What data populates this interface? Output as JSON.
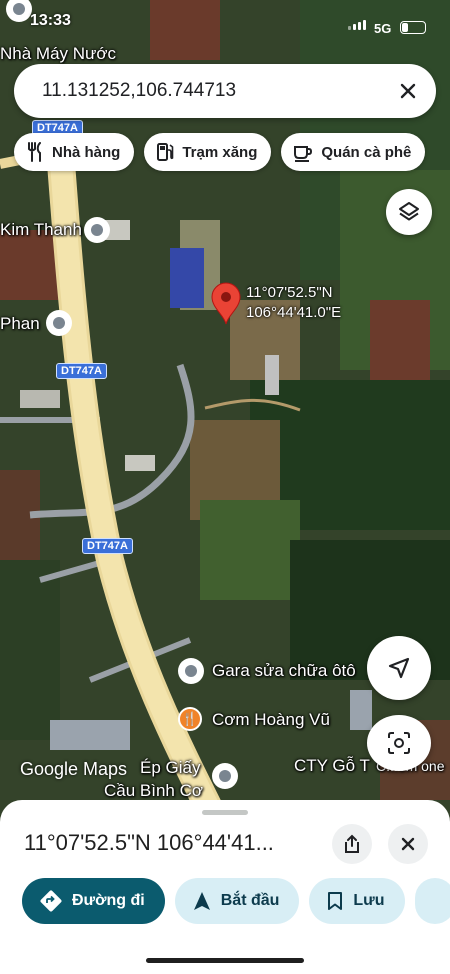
{
  "status_bar": {
    "time": "13:33",
    "network": "5G",
    "battery_percent": 25
  },
  "search": {
    "query": "11.131252,106.744713"
  },
  "chips": [
    {
      "label": "Nhà hàng",
      "icon": "restaurant-icon"
    },
    {
      "label": "Trạm xăng",
      "icon": "gas-station-icon"
    },
    {
      "label": "Quán cà phê",
      "icon": "coffee-icon"
    }
  ],
  "map": {
    "road_labels": [
      "DT747A",
      "DT747A",
      "DT747A"
    ],
    "places": [
      "Nhà Máy Nước",
      "Kim Thanh",
      "Phan",
      "Gara sửa chữa ôtô",
      "Cơm Hoàng Vũ",
      "Ép Giấy",
      "Cầu Bình Cơ",
      "CTY Gỗ T",
      "C...em one"
    ],
    "dropped_pin": {
      "lat": "11°07'52.5\"N",
      "lng": "106°44'41.0\"E"
    },
    "attribution": "Google Maps"
  },
  "sheet": {
    "title": "11°07'52.5\"N 106°44'41..."
  },
  "actions": [
    {
      "label": "Đường đi",
      "icon": "directions-icon"
    },
    {
      "label": "Bắt đầu",
      "icon": "navigation-arrow-icon"
    },
    {
      "label": "Lưu",
      "icon": "bookmark-icon"
    }
  ],
  "colors": {
    "accent": "#0b5b6e",
    "chip_light": "#d8eef5",
    "pin_red": "#ea4335",
    "road_shield": "#3a6fd8"
  }
}
